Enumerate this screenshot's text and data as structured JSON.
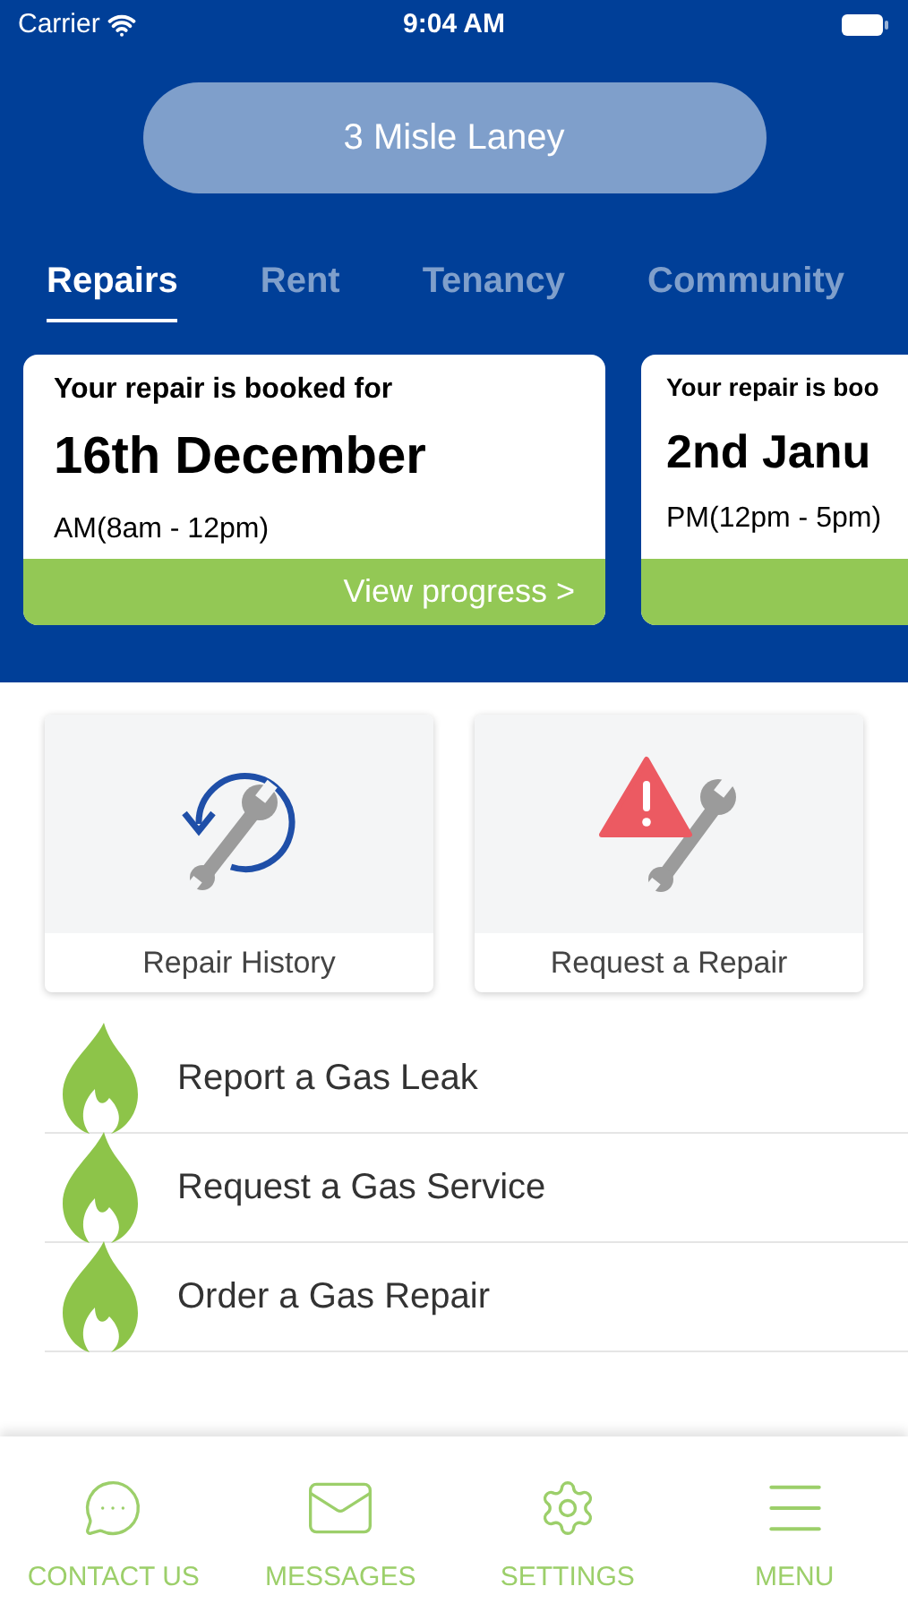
{
  "status_bar": {
    "carrier": "Carrier",
    "time": "9:04 AM"
  },
  "property": {
    "label": "3 Misle Laney"
  },
  "tabs": [
    {
      "label": "Repairs",
      "selected": true
    },
    {
      "label": "Rent",
      "selected": false
    },
    {
      "label": "Tenancy",
      "selected": false
    },
    {
      "label": "Community",
      "selected": false
    }
  ],
  "bookings": [
    {
      "heading": "Your repair is booked for",
      "date": "16th December",
      "slot": "AM(8am - 12pm)",
      "action": "View progress >"
    },
    {
      "heading": "Your repair is boo",
      "date": "2nd Janu",
      "slot": "PM(12pm - 5pm)"
    }
  ],
  "tiles": [
    {
      "kind": "history",
      "label": "Repair History"
    },
    {
      "kind": "request",
      "label": "Request a Repair"
    }
  ],
  "gas_actions": [
    {
      "label": "Report a Gas Leak"
    },
    {
      "label": "Request a Gas Service"
    },
    {
      "label": "Order a Gas Repair"
    }
  ],
  "bottom_nav": [
    {
      "kind": "contact",
      "label": "CONTACT US"
    },
    {
      "kind": "messages",
      "label": "MESSAGES"
    },
    {
      "kind": "settings",
      "label": "SETTINGS"
    },
    {
      "kind": "menu",
      "label": "MENU"
    }
  ]
}
